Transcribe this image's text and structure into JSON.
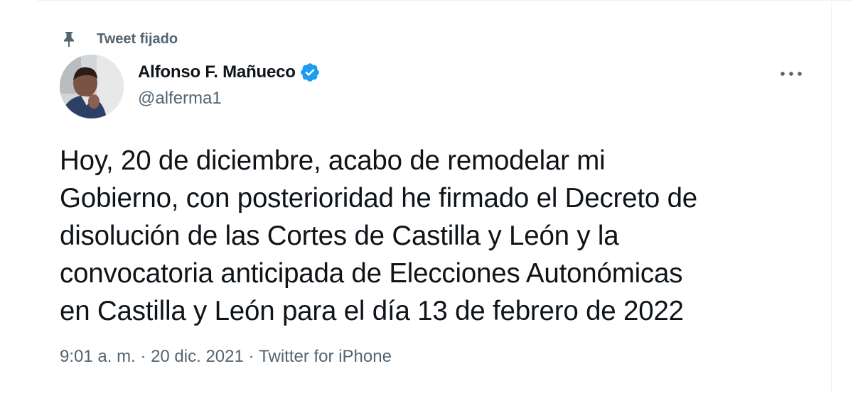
{
  "pinned": {
    "label": "Tweet fijado",
    "icon": "pin-icon"
  },
  "author": {
    "name": "Alfonso F. Mañueco",
    "handle": "@alferma1",
    "verified": true,
    "verified_color": "#1d9bf0"
  },
  "tweet": {
    "lines": [
      "Hoy, 20 de diciembre, acabo de remodelar mi",
      "Gobierno, con posterioridad he firmado el Decreto de",
      "disolución de las Cortes de Castilla y León y la",
      "convocatoria anticipada de Elecciones Autonómicas",
      "en Castilla y León para el día 13 de febrero de 2022"
    ]
  },
  "meta": {
    "time": "9:01 a. m.",
    "separator": " · ",
    "date": "20 dic. 2021",
    "source": "Twitter for iPhone"
  },
  "colors": {
    "text_primary": "#0f1419",
    "text_secondary": "#536471",
    "accent": "#1d9bf0"
  }
}
